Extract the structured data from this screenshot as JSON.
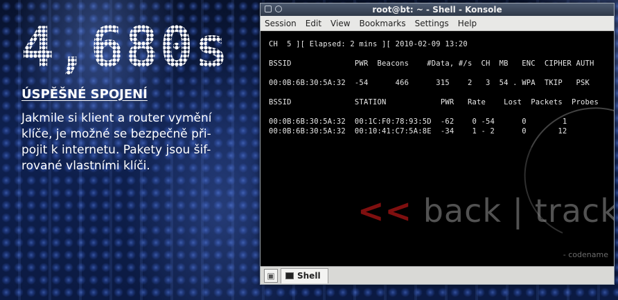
{
  "article": {
    "big_number": "4,680s",
    "heading": "ÚSPĚŠNÉ SPOJENÍ",
    "body_lines": [
      "Jakmile si klient a router vymění",
      "klíče, je možné se bezpečně při-",
      "pojit k internetu. Pakety jsou šif-",
      "rované vlastními klíči."
    ]
  },
  "window": {
    "title": "root@bt: ~ - Shell - Konsole",
    "menu": [
      "Session",
      "Edit",
      "View",
      "Bookmarks",
      "Settings",
      "Help"
    ]
  },
  "terminal": {
    "status": "CH  5 ][ Elapsed: 2 mins ][ 2010-02-09 13:20",
    "ap_header": "BSSID              PWR  Beacons    #Data, #/s  CH  MB   ENC  CIPHER AUTH",
    "ap_row": "00:0B:6B:30:5A:32  -54      466      315    2   3  54 . WPA  TKIP   PSK",
    "st_header": "BSSID              STATION            PWR   Rate    Lost  Packets  Probes",
    "st_rows": [
      "00:0B:6B:30:5A:32  00:1C:F0:78:93:5D  -62    0 -54      0        1",
      "00:0B:6B:30:5A:32  00:10:41:C7:5A:8E  -34    1 - 2      0       12"
    ]
  },
  "wallpaper": {
    "logo_chevrons": "<<",
    "logo_text": "back | track 4",
    "codename": "- codename"
  },
  "tabbar": {
    "tab_label": "Shell"
  }
}
